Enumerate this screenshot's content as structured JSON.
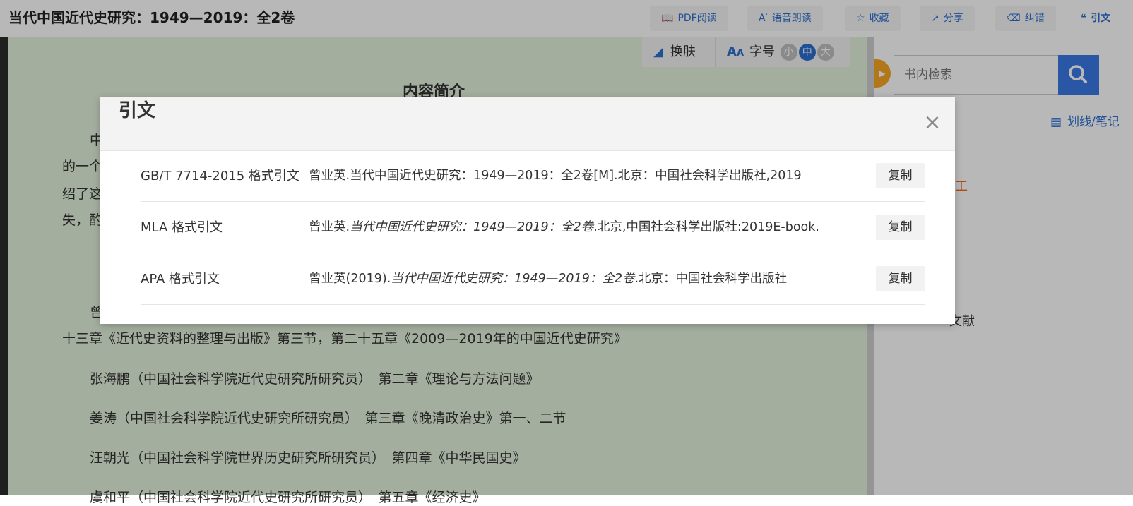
{
  "header": {
    "title": "当代中国近代史研究：1949—2019：全2卷",
    "buttons": {
      "pdf": "PDF阅读",
      "voice": "语音朗读",
      "favorite": "收藏",
      "share": "分享",
      "correct": "纠错",
      "cite": "引文"
    }
  },
  "reader": {
    "toolbar": {
      "skin": "换肤",
      "font_label": "字号",
      "font_sizes": [
        "小",
        "中",
        "大"
      ]
    },
    "section_heading": "内容简介",
    "visible_lines": [
      "中",
      "的一个",
      "绍了这",
      "失，酌",
      "曾",
      "十三章《近代史资料的整理与出版》第三节，第二十五章《2009—2019年的中国近代史研究》",
      "张海鹏（中国社会科学院近代史研究所研究员）　第二章《理论与方法问题》",
      "姜涛（中国社会科学院近代史研究所研究员）　第三章《晚清政治史》第一、二节",
      "汪朝光（中国社会科学院世界历史研究所研究员）　第四章《中华民国史》",
      "虞和平（中国社会科学院近代史研究所研究员）　第五章《经济史》"
    ]
  },
  "sidebar": {
    "search_placeholder": "书内检索",
    "notes_label": "划线/笔记",
    "toc_fragments": [
      "分工",
      "文献"
    ]
  },
  "modal": {
    "title": "引文",
    "close_symbol": "×",
    "copy_label": "复制",
    "rows": [
      {
        "label": "GB/T 7714-2015 格式引文",
        "text_plain": "曾业英.当代中国近代史研究：1949—2019：全2卷[M].北京：中国社会科学出版社,2019",
        "text_before": "",
        "text_italic": "",
        "text_after": ""
      },
      {
        "label": "MLA 格式引文",
        "text_plain": "",
        "text_before": "曾业英.",
        "text_italic": "当代中国近代史研究：1949—2019：全2卷",
        "text_after": ".北京,中国社会科学出版社:2019E-book."
      },
      {
        "label": "APA 格式引文",
        "text_plain": "",
        "text_before": "曾业英(2019).",
        "text_italic": "当代中国近代史研究：1949—2019：全2卷",
        "text_after": ".北京：中国社会科学出版社"
      }
    ]
  },
  "colors": {
    "accent_blue": "#2b6fd0",
    "search_blue": "#3b78e7",
    "reader_bg": "#e3f1dc",
    "orange": "#f06a1b",
    "collapse_tab": "#f5a623"
  }
}
